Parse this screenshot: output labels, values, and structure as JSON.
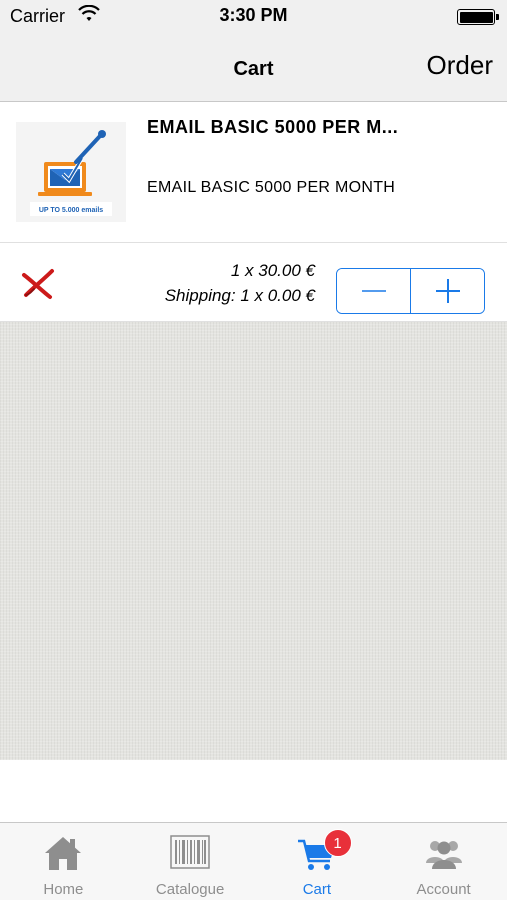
{
  "status_bar": {
    "carrier": "Carrier",
    "time": "3:30 PM",
    "wifi_icon": "wifi-icon",
    "battery_icon": "battery-icon"
  },
  "nav": {
    "title": "Cart",
    "order_label": "Order"
  },
  "cart_item": {
    "thumbnail_caption": "UP TO 5.000 emails",
    "title": "EMAIL BASIC 5000 PER M...",
    "description": "EMAIL BASIC 5000 PER MONTH",
    "unit_price": "1 x 30.00 €",
    "shipping": "Shipping: 1 x 0.00 €",
    "remove_icon": "remove-x-icon",
    "decrement_icon": "minus-icon",
    "increment_icon": "plus-icon"
  },
  "tabs": [
    {
      "label": "Home",
      "icon": "home-icon",
      "active": false
    },
    {
      "label": "Catalogue",
      "icon": "barcode-icon",
      "active": false
    },
    {
      "label": "Cart",
      "icon": "cart-icon",
      "active": true,
      "badge": "1"
    },
    {
      "label": "Account",
      "icon": "account-icon",
      "active": false
    }
  ],
  "colors": {
    "accent": "#1a7ae8",
    "badge": "#e8303a",
    "remove": "#cc1a1a",
    "inactive_tab": "#8e8e8e"
  }
}
